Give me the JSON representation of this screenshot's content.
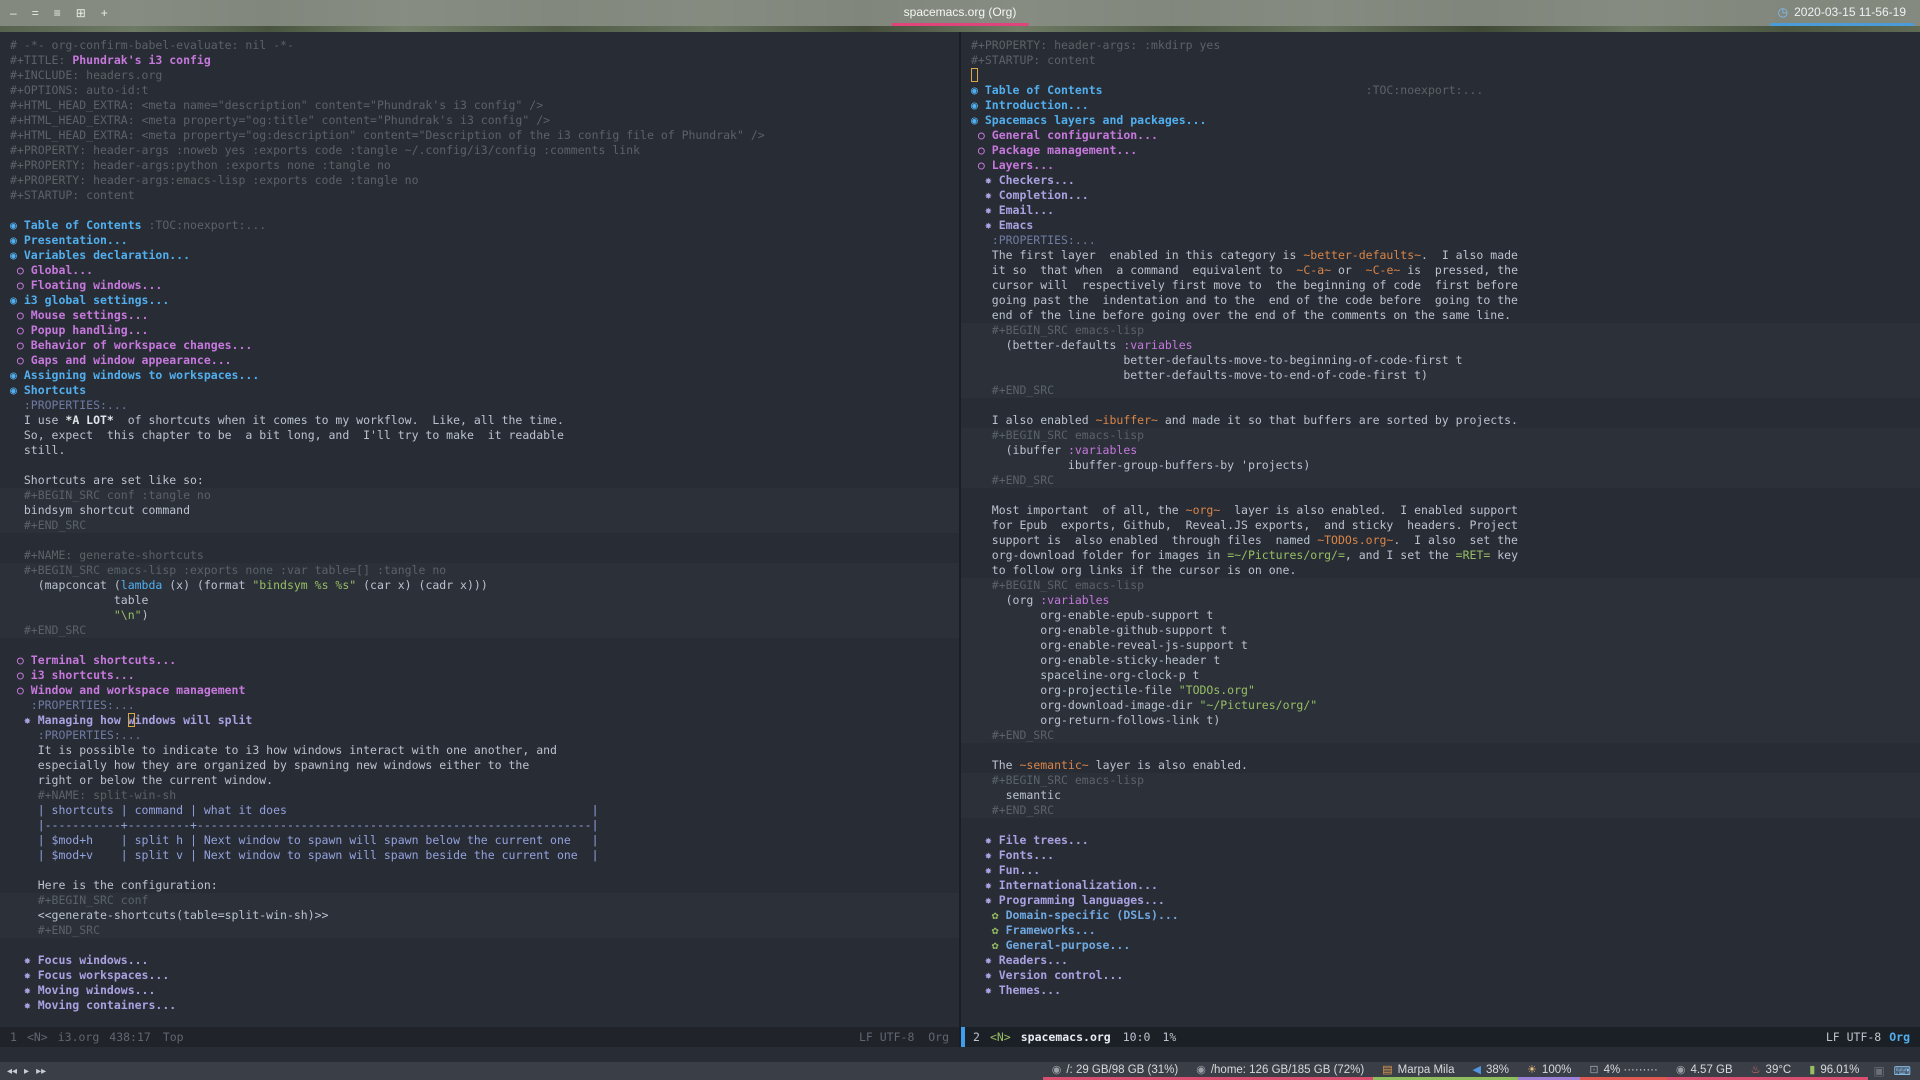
{
  "topbar": {
    "workspace_icons": [
      "–",
      "=",
      "≡",
      "⊞",
      "+"
    ],
    "window_title": "spacemacs.org (Org)",
    "title_underline": "#e0447c",
    "clock_icon": "◷",
    "datetime": "2020-03-15 11-56-19",
    "date_underline": "#4a9bd8"
  },
  "left_pane": {
    "lines": [
      [
        [
          "m",
          "# -*- org-confirm-babel-evaluate: nil -*-"
        ]
      ],
      [
        [
          "m",
          "#+TITLE: "
        ],
        [
          "t",
          "Phundrak's i3 config"
        ]
      ],
      [
        [
          "m",
          "#+INCLUDE: headers.org"
        ]
      ],
      [
        [
          "m",
          "#+OPTIONS: auto-id:t"
        ]
      ],
      [
        [
          "m",
          "#+HTML_HEAD_EXTRA: <meta name=\"description\" content=\"Phundrak's i3 config\" />"
        ]
      ],
      [
        [
          "m",
          "#+HTML_HEAD_EXTRA: <meta property=\"og:title\" content=\"Phundrak's i3 config\" />"
        ]
      ],
      [
        [
          "m",
          "#+HTML_HEAD_EXTRA: <meta property=\"og:description\" content=\"Description of the i3 config file of Phundrak\" />"
        ]
      ],
      [
        [
          "m",
          "#+PROPERTY: header-args :noweb yes :exports code :tangle ~/.config/i3/config :comments link"
        ]
      ],
      [
        [
          "m",
          "#+PROPERTY: header-args:python :exports none :tangle no"
        ]
      ],
      [
        [
          "m",
          "#+PROPERTY: header-args:emacs-lisp :exports code :tangle no"
        ]
      ],
      [
        [
          "m",
          "#+STARTUP: content"
        ]
      ],
      [],
      [
        [
          "h1",
          "◉ Table of Contents "
        ],
        [
          "m",
          ":TOC:noexport:..."
        ]
      ],
      [
        [
          "h1",
          "◉ Presentation..."
        ]
      ],
      [
        [
          "h1",
          "◉ Variables declaration..."
        ]
      ],
      [
        [
          "h2",
          " ○ Global..."
        ]
      ],
      [
        [
          "h2",
          " ○ Floating windows..."
        ]
      ],
      [
        [
          "h1",
          "◉ i3 global settings..."
        ]
      ],
      [
        [
          "h2",
          " ○ Mouse settings..."
        ]
      ],
      [
        [
          "h2",
          " ○ Popup handling..."
        ]
      ],
      [
        [
          "h2",
          " ○ Behavior of workspace changes..."
        ]
      ],
      [
        [
          "h2",
          " ○ Gaps and window appearance..."
        ]
      ],
      [
        [
          "h1",
          "◉ Assigning windows to workspaces..."
        ]
      ],
      [
        [
          "h1",
          "◉ Shortcuts"
        ]
      ],
      [
        [
          "p",
          "  :PROPERTIES:..."
        ]
      ],
      [
        [
          "tx",
          "  I use "
        ],
        [
          "b",
          "*A LOT*"
        ],
        [
          "tx",
          "  of shortcuts when it comes to my workflow.  Like, all the time."
        ]
      ],
      [
        [
          "tx",
          "  So, expect  this chapter to be  a bit long, and  I'll try to make  it readable"
        ]
      ],
      [
        [
          "tx",
          "  still."
        ]
      ],
      [],
      [
        [
          "tx",
          "  Shortcuts are set like so:"
        ]
      ],
      {
        "b": 1,
        "s": [
          [
            "m",
            "  #+BEGIN_SRC conf :tangle no"
          ]
        ]
      },
      {
        "b": 1,
        "s": [
          [
            "tx",
            "  bindsym shortcut command"
          ]
        ]
      },
      {
        "b": 1,
        "s": [
          [
            "m",
            "  #+END_SRC"
          ]
        ]
      },
      [],
      [
        [
          "m",
          "  #+NAME: generate-shortcuts"
        ]
      ],
      {
        "b": 1,
        "s": [
          [
            "m",
            "  #+BEGIN_SRC emacs-lisp :exports none :var table=[] :tangle no"
          ]
        ]
      },
      {
        "b": 1,
        "s": [
          [
            "tx",
            "    (mapconcat ("
          ],
          [
            "k",
            "lambda"
          ],
          [
            "tx",
            " (x) (format "
          ],
          [
            "s",
            "\"bindsym %s %s\""
          ],
          [
            "tx",
            " (car x) (cadr x)))"
          ]
        ]
      },
      {
        "b": 1,
        "s": [
          [
            "tx",
            "               table"
          ]
        ]
      },
      {
        "b": 1,
        "s": [
          [
            "tx",
            "               "
          ],
          [
            "s",
            "\"\\n\""
          ],
          [
            "tx",
            ")"
          ]
        ]
      },
      {
        "b": 1,
        "s": [
          [
            "m",
            "  #+END_SRC"
          ]
        ]
      },
      [],
      [
        [
          "h2",
          " ○ Terminal shortcuts..."
        ]
      ],
      [
        [
          "h2",
          " ○ i3 shortcuts..."
        ]
      ],
      [
        [
          "h2",
          " ○ Window and workspace management"
        ]
      ],
      [
        [
          "p",
          "   :PROPERTIES:..."
        ]
      ],
      [
        [
          "h3",
          "  ✸ Managing how "
        ],
        [
          "h3 cur",
          "w"
        ],
        [
          "h3",
          "indows will split"
        ]
      ],
      [
        [
          "p",
          "    :PROPERTIES:..."
        ]
      ],
      [
        [
          "tx",
          "    It is possible to indicate to i3 how windows interact with one another, and"
        ]
      ],
      [
        [
          "tx",
          "    especially how they are organized by spawning new windows either to the"
        ]
      ],
      [
        [
          "tx",
          "    right or below the current window."
        ]
      ],
      [
        [
          "m",
          "    #+NAME: split-win-sh"
        ]
      ],
      [
        [
          "tb",
          "    | shortcuts | command | what it does                                            |"
        ]
      ],
      [
        [
          "tb",
          "    |-----------+---------+---------------------------------------------------------|"
        ]
      ],
      [
        [
          "tb",
          "    | $mod+h    | split h | Next window to spawn will spawn below the current one   |"
        ]
      ],
      [
        [
          "tb",
          "    | $mod+v    | split v | Next window to spawn will spawn beside the current one  |"
        ]
      ],
      [],
      [
        [
          "tx",
          "    Here is the configuration:"
        ]
      ],
      {
        "b": 1,
        "s": [
          [
            "m",
            "    #+BEGIN_SRC conf"
          ]
        ]
      },
      {
        "b": 1,
        "s": [
          [
            "tx",
            "    <<generate-shortcuts(table=split-win-sh)>>"
          ]
        ]
      },
      {
        "b": 1,
        "s": [
          [
            "m",
            "    #+END_SRC"
          ]
        ]
      },
      [],
      [
        [
          "h3",
          "  ✸ Focus windows..."
        ]
      ],
      [
        [
          "h3",
          "  ✸ Focus workspaces..."
        ]
      ],
      [
        [
          "h3",
          "  ✸ Moving windows..."
        ]
      ],
      [
        [
          "h3",
          "  ✸ Moving containers..."
        ]
      ]
    ]
  },
  "right_pane": {
    "lines": [
      [
        [
          "m",
          "#+PROPERTY: header-args: :mkdirp yes"
        ]
      ],
      [
        [
          "m",
          "#+STARTUP: content"
        ]
      ],
      [
        [
          "cur",
          " "
        ]
      ],
      [
        [
          "h1",
          "◉ Table of Contents"
        ],
        [
          "m",
          "                                      :TOC:noexport:..."
        ]
      ],
      [
        [
          "h1",
          "◉ Introduction..."
        ]
      ],
      [
        [
          "h1",
          "◉ Spacemacs layers and packages..."
        ]
      ],
      [
        [
          "h2",
          " ○ General configuration..."
        ]
      ],
      [
        [
          "h2",
          " ○ Package management..."
        ]
      ],
      [
        [
          "h2",
          " ○ Layers..."
        ]
      ],
      [
        [
          "h3",
          "  ✸ Checkers..."
        ]
      ],
      [
        [
          "h3",
          "  ✸ Completion..."
        ]
      ],
      [
        [
          "h3",
          "  ✸ Email..."
        ]
      ],
      [
        [
          "h3",
          "  ✸ Emacs"
        ]
      ],
      [
        [
          "p",
          "   :PROPERTIES:..."
        ]
      ],
      [
        [
          "tx",
          "   The first layer  enabled in this category is "
        ],
        [
          "c",
          "~better-defaults~"
        ],
        [
          "tx",
          ".  I also made"
        ]
      ],
      [
        [
          "tx",
          "   it so  that when  a command  equivalent to  "
        ],
        [
          "c",
          "~C-a~"
        ],
        [
          "tx",
          " or  "
        ],
        [
          "c",
          "~C-e~"
        ],
        [
          "tx",
          " is  pressed, the"
        ]
      ],
      [
        [
          "tx",
          "   cursor will  respectively first move to  the beginning of code  first before"
        ]
      ],
      [
        [
          "tx",
          "   going past the  indentation and to the  end of the code before  going to the"
        ]
      ],
      [
        [
          "tx",
          "   end of the line before going over the end of the comments on the same line."
        ]
      ],
      {
        "b": 1,
        "s": [
          [
            "m",
            "   #+BEGIN_SRC emacs-lisp"
          ]
        ]
      },
      {
        "b": 1,
        "s": [
          [
            "tx",
            "     (better-defaults "
          ],
          [
            "va",
            ":variables"
          ]
        ]
      },
      {
        "b": 1,
        "s": [
          [
            "tx",
            "                      better-defaults-move-to-beginning-of-code-first t"
          ]
        ]
      },
      {
        "b": 1,
        "s": [
          [
            "tx",
            "                      better-defaults-move-to-end-of-code-first t)"
          ]
        ]
      },
      {
        "b": 1,
        "s": [
          [
            "m",
            "   #+END_SRC"
          ]
        ]
      },
      [],
      [
        [
          "tx",
          "   I also enabled "
        ],
        [
          "c",
          "~ibuffer~"
        ],
        [
          "tx",
          " and made it so that buffers are sorted by projects."
        ]
      ],
      {
        "b": 1,
        "s": [
          [
            "m",
            "   #+BEGIN_SRC emacs-lisp"
          ]
        ]
      },
      {
        "b": 1,
        "s": [
          [
            "tx",
            "     (ibuffer "
          ],
          [
            "va",
            ":variables"
          ]
        ]
      },
      {
        "b": 1,
        "s": [
          [
            "tx",
            "              ibuffer-group-buffers-by 'projects)"
          ]
        ]
      },
      {
        "b": 1,
        "s": [
          [
            "m",
            "   #+END_SRC"
          ]
        ]
      },
      [],
      [
        [
          "tx",
          "   Most important  of all, the "
        ],
        [
          "c",
          "~org~"
        ],
        [
          "tx",
          "  layer is also enabled.  I enabled support"
        ]
      ],
      [
        [
          "tx",
          "   for Epub  exports, Github,  Reveal.JS exports,  and sticky  headers. Project"
        ]
      ],
      [
        [
          "tx",
          "   support is  also enabled  through files  named "
        ],
        [
          "c",
          "~TODOs.org~"
        ],
        [
          "tx",
          ".  I also  set the"
        ]
      ],
      [
        [
          "tx",
          "   org-download folder for images in "
        ],
        [
          "v",
          "=~/Pictures/org/="
        ],
        [
          "tx",
          ", and I set the "
        ],
        [
          "v",
          "=RET="
        ],
        [
          "tx",
          " key"
        ]
      ],
      [
        [
          "tx",
          "   to follow org links if the cursor is on one."
        ]
      ],
      {
        "b": 1,
        "s": [
          [
            "m",
            "   #+BEGIN_SRC emacs-lisp"
          ]
        ]
      },
      {
        "b": 1,
        "s": [
          [
            "tx",
            "     (org "
          ],
          [
            "va",
            ":variables"
          ]
        ]
      },
      {
        "b": 1,
        "s": [
          [
            "tx",
            "          org-enable-epub-support t"
          ]
        ]
      },
      {
        "b": 1,
        "s": [
          [
            "tx",
            "          org-enable-github-support t"
          ]
        ]
      },
      {
        "b": 1,
        "s": [
          [
            "tx",
            "          org-enable-reveal-js-support t"
          ]
        ]
      },
      {
        "b": 1,
        "s": [
          [
            "tx",
            "          org-enable-sticky-header t"
          ]
        ]
      },
      {
        "b": 1,
        "s": [
          [
            "tx",
            "          spaceline-org-clock-p t"
          ]
        ]
      },
      {
        "b": 1,
        "s": [
          [
            "tx",
            "          org-projectile-file "
          ],
          [
            "s",
            "\"TODOs.org\""
          ]
        ]
      },
      {
        "b": 1,
        "s": [
          [
            "tx",
            "          org-download-image-dir "
          ],
          [
            "s",
            "\"~/Pictures/org/\""
          ]
        ]
      },
      {
        "b": 1,
        "s": [
          [
            "tx",
            "          org-return-follows-link t)"
          ]
        ]
      },
      {
        "b": 1,
        "s": [
          [
            "m",
            "   #+END_SRC"
          ]
        ]
      },
      [],
      [
        [
          "tx",
          "   The "
        ],
        [
          "c",
          "~semantic~"
        ],
        [
          "tx",
          " layer is also enabled."
        ]
      ],
      {
        "b": 1,
        "s": [
          [
            "m",
            "   #+BEGIN_SRC emacs-lisp"
          ]
        ]
      },
      {
        "b": 1,
        "s": [
          [
            "tx",
            "     semantic"
          ]
        ]
      },
      {
        "b": 1,
        "s": [
          [
            "m",
            "   #+END_SRC"
          ]
        ]
      },
      [],
      [
        [
          "h3",
          "  ✸ File trees..."
        ]
      ],
      [
        [
          "h3",
          "  ✸ Fonts..."
        ]
      ],
      [
        [
          "h3",
          "  ✸ Fun..."
        ]
      ],
      [
        [
          "h3",
          "  ✸ Internationalization..."
        ]
      ],
      [
        [
          "h3",
          "  ✸ Programming languages..."
        ]
      ],
      [
        [
          "h4b",
          "   ✿ "
        ],
        [
          "h4",
          "Domain-specific (DSLs)..."
        ]
      ],
      [
        [
          "h4b",
          "   ✿ "
        ],
        [
          "h4",
          "Frameworks..."
        ]
      ],
      [
        [
          "h4b",
          "   ✿ "
        ],
        [
          "h4",
          "General-purpose..."
        ]
      ],
      [
        [
          "h3",
          "  ✸ Readers..."
        ]
      ],
      [
        [
          "h3",
          "  ✸ Version control..."
        ]
      ],
      [
        [
          "h3",
          "  ✸ Themes..."
        ]
      ]
    ]
  },
  "left_modeline": {
    "win": "1",
    "state": "<N>",
    "buffer": "i3.org",
    "position": "438:17",
    "scroll": "Top",
    "right": "LF UTF-8  Org"
  },
  "right_modeline": {
    "win": "2",
    "state": "<N>",
    "buffer": "spacemacs.org",
    "position": "10:0",
    "scroll": "1%",
    "eol_enc": "LF UTF-8",
    "major": "Org"
  },
  "bottombar": {
    "player_controls": [
      "◂◂",
      "▸",
      "▸▸"
    ],
    "modules": [
      {
        "name": "disk-root",
        "icon": "◉",
        "icon_color": "#9aa0a6",
        "text": "/: 29 GB/98 GB (31%)",
        "underline": "#d94f6f"
      },
      {
        "name": "disk-home",
        "icon": "◉",
        "icon_color": "#9aa0a6",
        "text": "/home: 126 GB/185 GB (72%)",
        "underline": "#d94f6f"
      },
      {
        "name": "mpd-song",
        "icon": "▤",
        "icon_color": "#e09a4e",
        "text": "Marpa Mila",
        "underline": "#8fbe5f"
      },
      {
        "name": "volume",
        "icon": "◀",
        "icon_color": "#5295e2",
        "text": "38%",
        "underline": "#8fbe5f"
      },
      {
        "name": "brightness",
        "icon": "☀",
        "icon_color": "#ecbe7b",
        "text": "100%",
        "underline": "#9d80d8"
      },
      {
        "name": "cpu",
        "icon": "⊡",
        "icon_color": "#9aa0a6",
        "text": "4% ·········",
        "underline": "#e05a51"
      },
      {
        "name": "memory",
        "icon": "◉",
        "icon_color": "#9aa0a6",
        "text": "4.57 GB",
        "underline": "#d94f6f"
      },
      {
        "name": "temperature",
        "icon": "♨",
        "icon_color": "#e06c75",
        "text": "39°C",
        "underline": "#d94f6f"
      },
      {
        "name": "battery",
        "icon": "▮",
        "icon_color": "#98be65",
        "text": "96.01%",
        "underline": "#d94f6f"
      }
    ],
    "tray_icons": [
      {
        "name": "chat-tray-icon",
        "glyph": "▣",
        "color": "#6a7076"
      },
      {
        "name": "keyboard-tray-icon",
        "glyph": "⌨",
        "color": "#8fc7f7"
      }
    ]
  }
}
